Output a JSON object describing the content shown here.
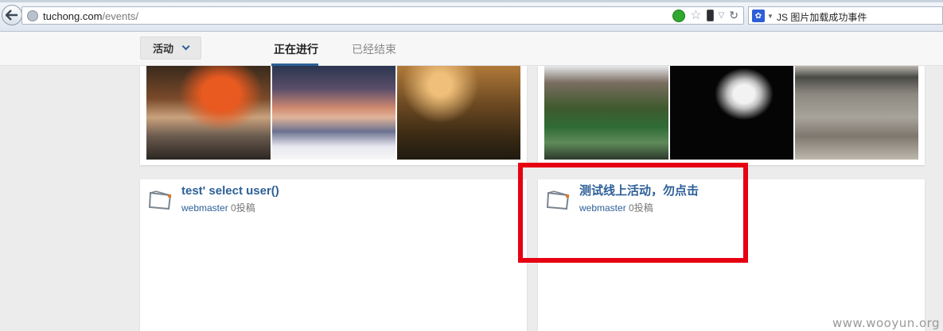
{
  "browser": {
    "url_domain": "tuchong.com",
    "url_path": "/events/",
    "search_text": "JS 图片加载成功事件"
  },
  "site_nav": {
    "dropdown_label": "活动",
    "tabs": [
      {
        "label": "正在进行",
        "active": true
      },
      {
        "label": "已经结束",
        "active": false
      }
    ]
  },
  "events": [
    {
      "title": "test' select user()",
      "author": "webmaster",
      "count": "0投稿"
    },
    {
      "title": "测试线上活动，勿点击",
      "author": "webmaster",
      "count": "0投稿"
    }
  ],
  "highlight_color": "#e60012",
  "accent_color": "#2d5f98",
  "watermark": "www.wooyun.org"
}
